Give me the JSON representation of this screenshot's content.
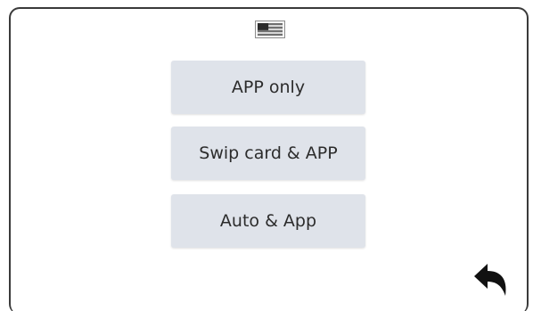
{
  "modes": [
    {
      "label": "APP only"
    },
    {
      "label": "Swip card & APP"
    },
    {
      "label": "Auto & App"
    }
  ],
  "icons": {
    "flag": "us-flag-icon",
    "back": "back-arrow-icon"
  },
  "colors": {
    "button_bg": "#dfe3ea",
    "button_text": "#2c2c2c",
    "frame_border": "#3a3a3a",
    "icon": "#111111"
  }
}
